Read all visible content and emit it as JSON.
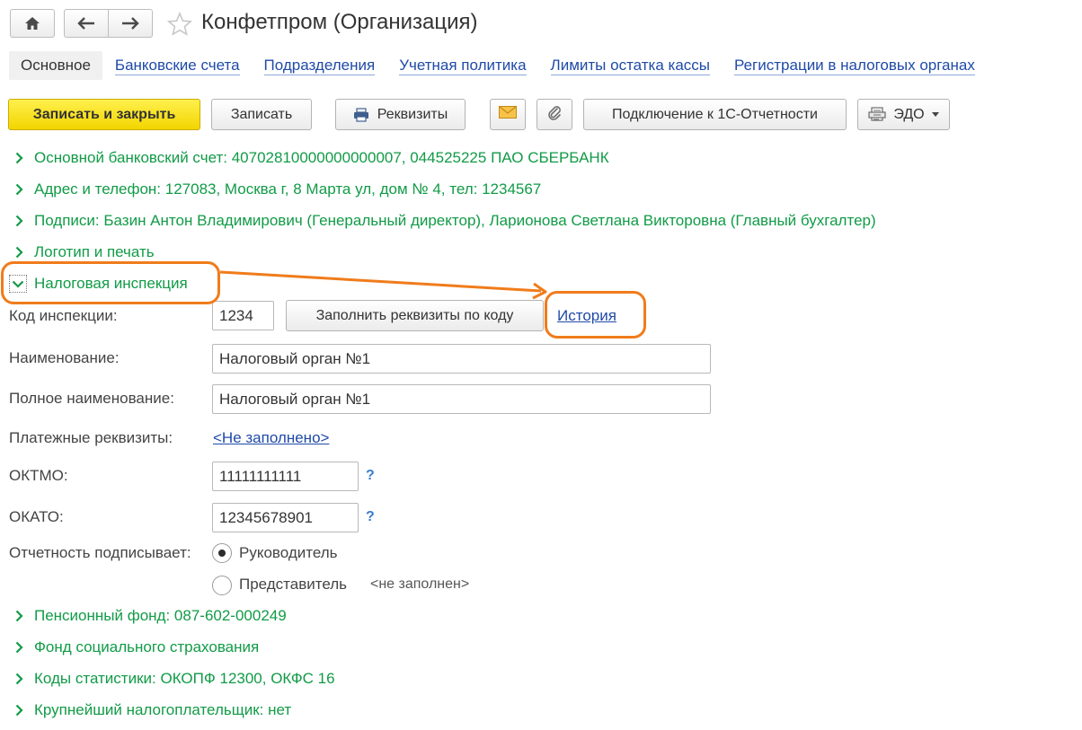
{
  "window": {
    "title": "Конфетпром (Организация)",
    "nav": {
      "home_icon": "home-icon",
      "back_icon": "arrow-left-icon",
      "forward_icon": "arrow-right-icon",
      "favorite_icon": "star-icon"
    }
  },
  "tabs": [
    {
      "label": "Основное",
      "active": true
    },
    {
      "label": "Банковские счета"
    },
    {
      "label": "Подразделения"
    },
    {
      "label": "Учетная политика"
    },
    {
      "label": "Лимиты остатка кассы"
    },
    {
      "label": "Регистрации в налоговых органах"
    }
  ],
  "toolbar": {
    "save_close": "Записать и закрыть",
    "save": "Записать",
    "requisites": "Реквизиты",
    "connect_reporting": "Подключение к 1С-Отчетности",
    "edo": "ЭДО"
  },
  "groups": {
    "bank_account": "Основной банковский счет: 40702810000000000007, 044525225 ПАО СБЕРБАНК",
    "address": "Адрес и телефон: 127083, Москва г, 8 Марта ул, дом № 4, тел: 1234567",
    "signatures": "Подписи: Базин Антон Владимирович (Генеральный директор), Ларионова Светлана Викторовна (Главный бухгалтер)",
    "logo": "Логотип и печать",
    "tax_office": "Налоговая инспекция",
    "pension_fund": "Пенсионный фонд: 087-602-000249",
    "social_fund": "Фонд социального страхования",
    "stat_codes": "Коды статистики: ОКОПФ 12300, ОКФС 16",
    "large_taxpayer": "Крупнейший налогоплательщик: нет"
  },
  "tax_form": {
    "code_label": "Код инспекции:",
    "code_value": "1234",
    "fill_button": "Заполнить реквизиты по коду",
    "history_link": "История",
    "name_label": "Наименование:",
    "name_value": "Налоговый орган №1",
    "full_name_label": "Полное наименование:",
    "full_name_value": "Налоговый орган №1",
    "payment_label": "Платежные реквизиты:",
    "payment_link": "<Не заполнено>",
    "oktmo_label": "ОКТМО:",
    "oktmo_value": "11111111111",
    "okato_label": "ОКАТО:",
    "okato_value": "12345678901",
    "help_mark": "?",
    "signer_label": "Отчетность подписывает:",
    "signer_options": [
      {
        "label": "Руководитель",
        "selected": true
      },
      {
        "label": "Представитель",
        "selected": false
      }
    ],
    "representative_placeholder": "<не заполнен>"
  },
  "colors": {
    "group_green": "#119b47",
    "link_blue": "#1f4aa8",
    "primary_yellow": "#f2d500",
    "annotation_orange": "#f07c1b"
  }
}
